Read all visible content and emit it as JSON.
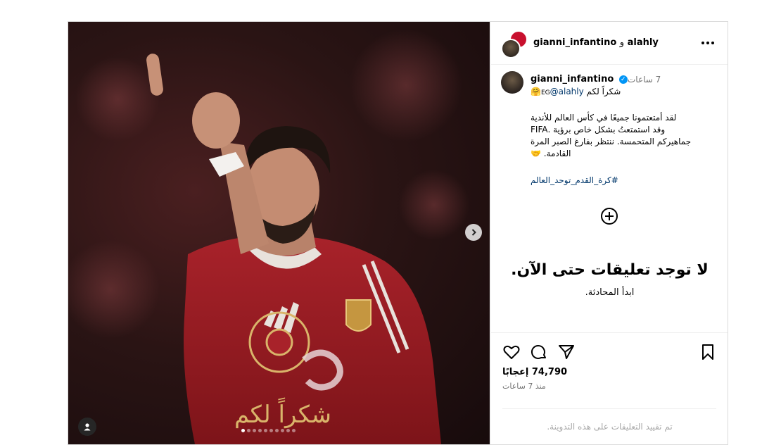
{
  "post": {
    "media": {
      "overlay_text": "شكراً لكم",
      "slide_count": 10,
      "active_slide": 1,
      "icons": {
        "tag": "user-tag-icon",
        "next": "chevron-right-icon"
      }
    },
    "header": {
      "user1": "alahly",
      "conjunction": "و",
      "user2": "gianni_infantino",
      "more_icon": "more-horizontal-icon"
    },
    "caption": {
      "username": "gianni_infantino",
      "verified_glyph": "✓",
      "time": "7 ساعات",
      "line1_mention": "@alahly",
      "line1_text": "شكراً لكم ",
      "line1_flag": "EG",
      "line1_emoji": "🤗",
      "body_lines": [
        "لقد أمتعتمونا جميعًا في كأس العالم للأندية",
        "وقد استمتعتُ بشكل خاص برؤية .FIFA",
        "جماهيركم المتحمسة. ننتظر بفارغ الصبر المرة",
        "القادمة. 🤝"
      ],
      "hashtag": "#كرة_القدم_توحد_العالم"
    },
    "comments": {
      "add_icon": "plus-circle-icon",
      "empty_title": "لا توجد تعليقات حتى الآن.",
      "empty_subtitle": "ابدأ المحادثة."
    },
    "actions": {
      "icons": [
        "heart-icon",
        "comment-icon",
        "share-icon",
        "bookmark-icon"
      ],
      "likes_count": "74,790",
      "likes_label": "إعجابًا",
      "since": "منذ 7 ساعات",
      "comments_disabled": "تم تقييد التعليقات على هذه التدوينة."
    }
  },
  "colors": {
    "link": "#00376b",
    "verified": "#0095f6",
    "muted": "#737373",
    "gold": "#d9b46a",
    "jersey": "#9b1b22"
  }
}
